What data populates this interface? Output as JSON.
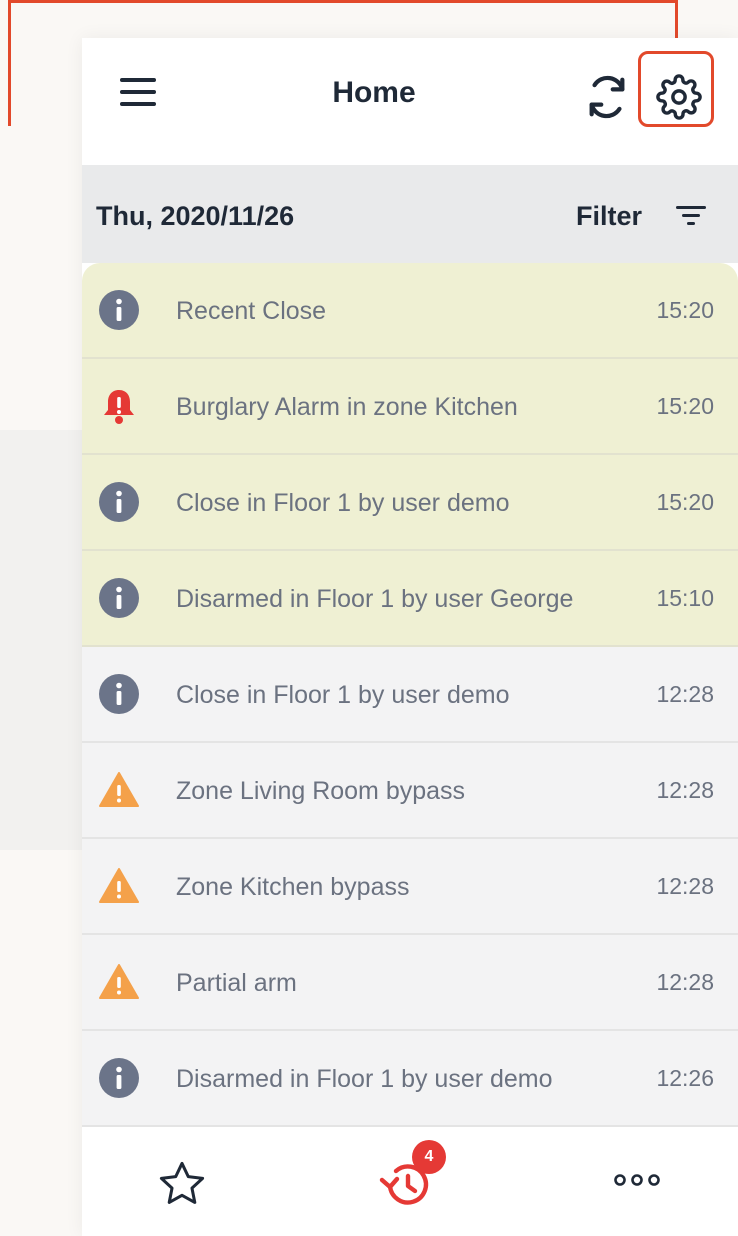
{
  "header": {
    "title": "Home",
    "menu_icon": "hamburger-icon",
    "refresh_icon": "refresh-icon",
    "settings_icon": "gear-icon"
  },
  "date_bar": {
    "date": "Thu, 2020/11/26",
    "filter_label": "Filter",
    "filter_icon": "filter-lines-icon"
  },
  "events": [
    {
      "type": "info",
      "text": "Recent Close",
      "time": "15:20",
      "recent": true
    },
    {
      "type": "alarm",
      "text": "Burglary Alarm in zone Kitchen",
      "time": "15:20",
      "recent": true
    },
    {
      "type": "info",
      "text": "Close in Floor 1 by user demo",
      "time": "15:20",
      "recent": true
    },
    {
      "type": "info",
      "text": "Disarmed in Floor 1 by user George",
      "time": "15:10",
      "recent": true
    },
    {
      "type": "info",
      "text": "Close in Floor 1 by user demo",
      "time": "12:28",
      "recent": false
    },
    {
      "type": "warning",
      "text": "Zone Living Room bypass",
      "time": "12:28",
      "recent": false
    },
    {
      "type": "warning",
      "text": "Zone Kitchen bypass",
      "time": "12:28",
      "recent": false
    },
    {
      "type": "warning",
      "text": "Partial arm",
      "time": "12:28",
      "recent": false
    },
    {
      "type": "info",
      "text": "Disarmed in Floor 1 by user demo",
      "time": "12:26",
      "recent": false
    }
  ],
  "tabbar": {
    "favorites_icon": "star-icon",
    "history_icon": "history-icon",
    "history_badge": "4",
    "more_icon": "more-dots-icon"
  },
  "colors": {
    "accent": "#e2492b",
    "recent_bg": "#eff0d3",
    "info": "#6b7489",
    "alarm": "#e53935",
    "warning": "#f4a14a"
  }
}
